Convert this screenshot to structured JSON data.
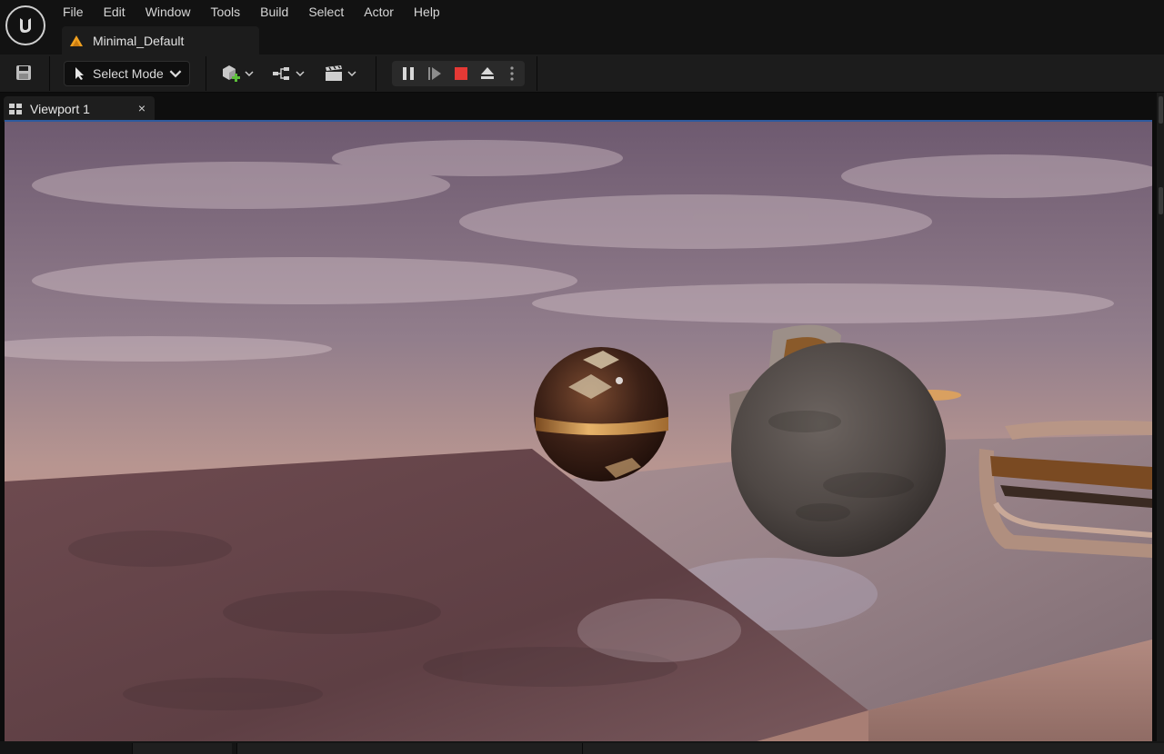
{
  "app": {
    "logo_icon": "unreal-engine-logo-icon",
    "menu": [
      "File",
      "Edit",
      "Window",
      "Tools",
      "Build",
      "Select",
      "Actor",
      "Help"
    ],
    "level_tab": {
      "label": "Minimal_Default",
      "icon": "level-warning-icon"
    }
  },
  "toolbar": {
    "save_icon": "save-icon",
    "mode": {
      "label": "Select Mode",
      "icon": "select-cursor-icon"
    },
    "icons": [
      "add-actor-icon",
      "blueprint-icon",
      "cinematics-icon"
    ],
    "play_controls": [
      "pause-icon",
      "frame-advance-icon",
      "stop-icon",
      "eject-icon",
      "more-options-icon"
    ],
    "stop_color": "#e53935"
  },
  "viewport": {
    "tab_label": "Viewport 1",
    "tab_icon": "viewport-layout-icon",
    "close_glyph": "×",
    "scene_objects": [
      "sky",
      "floor-slab",
      "glass-sphere",
      "stone-sphere",
      "chair-back",
      "chair-front"
    ]
  },
  "colors": {
    "accent": "#2d5a9e",
    "sky_top": "#6e5a70",
    "sky_horizon": "#c7958a",
    "floor": "#6b4a4c"
  }
}
